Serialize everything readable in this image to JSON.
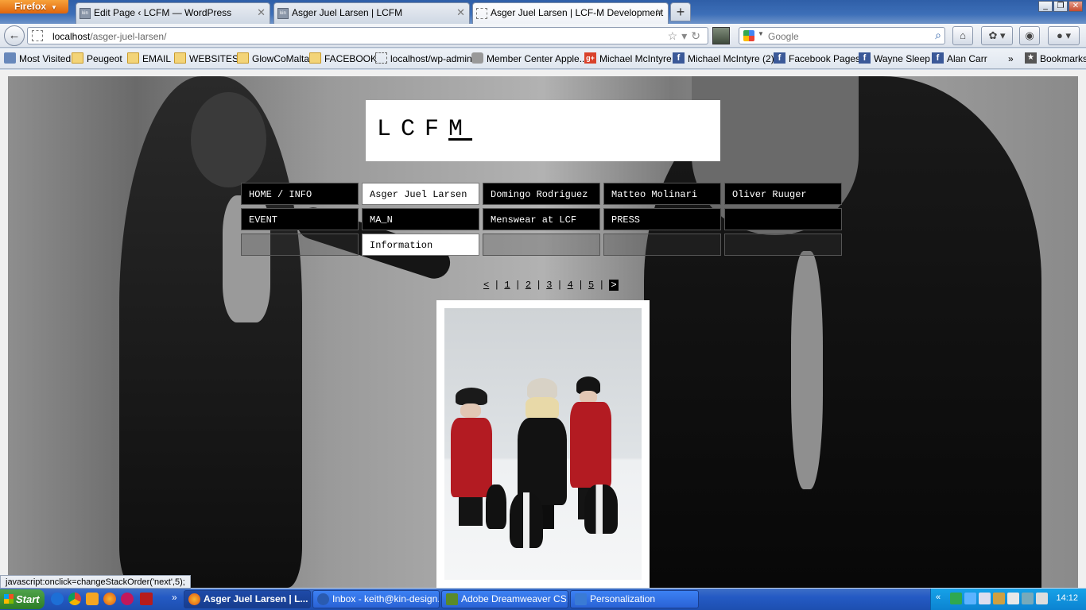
{
  "browser": {
    "menu_button": "Firefox",
    "tabs": [
      {
        "title": "Edit Page ‹ LCFM — WordPress",
        "favicon": "kin"
      },
      {
        "title": "Asger Juel Larsen | LCFM",
        "favicon": "kin"
      },
      {
        "title": "Asger Juel Larsen | LCF-M Development",
        "favicon": ""
      }
    ],
    "url_host": "localhost",
    "url_path": "/asger-juel-larsen/",
    "search_placeholder": "Google",
    "bookmarks": [
      {
        "label": "Most Visited",
        "icon": "most-visited-icon"
      },
      {
        "label": "Peugeot",
        "icon": "folder-icon"
      },
      {
        "label": "EMAIL",
        "icon": "folder-icon"
      },
      {
        "label": "WEBSITES",
        "icon": "folder-icon"
      },
      {
        "label": "GlowCoMalta",
        "icon": "folder-icon"
      },
      {
        "label": "FACEBOOK",
        "icon": "folder-icon"
      },
      {
        "label": "localhost/wp-admin",
        "icon": "page-icon"
      },
      {
        "label": "Member Center Apple...",
        "icon": "apple-icon"
      },
      {
        "label": "Michael McIntyre",
        "icon": "google-plus-icon"
      },
      {
        "label": "Michael McIntyre (2)",
        "icon": "facebook-icon"
      },
      {
        "label": "Facebook Pages",
        "icon": "facebook-icon"
      },
      {
        "label": "Wayne Sleep",
        "icon": "facebook-icon"
      },
      {
        "label": "Alan Carr",
        "icon": "facebook-icon"
      }
    ],
    "bookmarks_menu": "Bookmarks",
    "status_text": "javascript:onclick=changeStackOrder('next',5);"
  },
  "site": {
    "logo": {
      "plain": "LCF",
      "underlined": "M"
    },
    "menu": {
      "row1": [
        "HOME / INFO",
        "Asger Juel Larsen",
        "Domingo Rodriguez",
        "Matteo Molinari",
        "Oliver Ruuger"
      ],
      "row2": [
        "EVENT",
        "MA_N",
        "Menswear at LCF",
        "PRESS",
        ""
      ],
      "row3": [
        "",
        "Information",
        "",
        "",
        ""
      ]
    },
    "pager": {
      "prev": "<",
      "pages": [
        "1",
        "2",
        "3",
        "4",
        "5"
      ],
      "next": ">"
    }
  },
  "taskbar": {
    "start": "Start",
    "tasks": [
      {
        "label": "Asger Juel Larsen | L...",
        "icon": "firefox-icon"
      },
      {
        "label": "Inbox - keith@kin-design...",
        "icon": "thunderbird-icon"
      },
      {
        "label": "Adobe Dreamweaver CS...",
        "icon": "dreamweaver-icon"
      },
      {
        "label": "Personalization",
        "icon": "personalization-icon"
      }
    ],
    "clock": "14:12"
  },
  "colors": {
    "accent": "#245ac4",
    "page_bg": "#f0f0f0",
    "menu_dark": "#000000",
    "menu_light": "#ffffff"
  }
}
